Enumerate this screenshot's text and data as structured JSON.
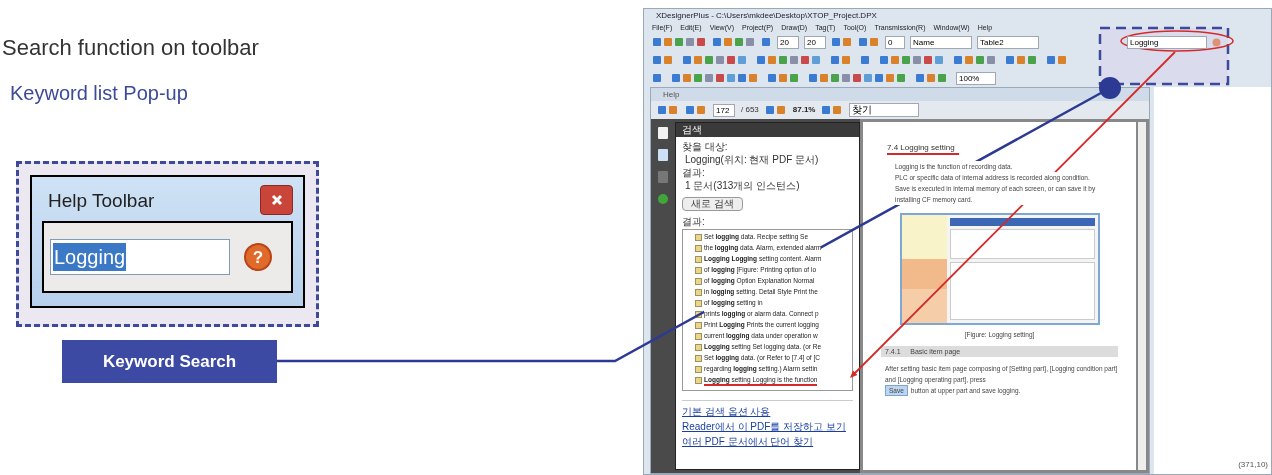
{
  "heading": "Search function on toolbar",
  "subheading": "Keyword list Pop-up",
  "popup": {
    "title": "Help Toolbar",
    "field_value": "Logging",
    "help_glyph": "?"
  },
  "callout_label": "Keyword Search",
  "app": {
    "title": "XDesignerPlus - C:\\Users\\mkdee\\Desktop\\XTOP_Project.DPX",
    "menu": [
      "File(F)",
      "Edit(E)",
      "View(V)",
      "Project(P)",
      "Draw(D)",
      "Tag(T)",
      "Tool(O)",
      "Transmission(R)",
      "Window(W)",
      "Help"
    ],
    "toolbar": {
      "width_value": "20",
      "height_value": "20",
      "layer_value": "0",
      "name_dropdown": "Name",
      "table_dropdown": "Table2",
      "search_value": "Logging",
      "zoom_dropdown": "100%"
    },
    "status": "(371,10)"
  },
  "help_window": {
    "title": "Help",
    "page_current": "172",
    "page_total": "/ 653",
    "zoom": "87.1%",
    "find_field": "찾기",
    "search_panel": {
      "title": "검색",
      "find_label": "찾을 대상:",
      "find_value": "Logging(위치: 현재 PDF 문서)",
      "result_label": "결과:",
      "result_value": "1 문서(313개의 인스턴스)",
      "new_search_button": "새로 검색",
      "results_label": "결과:",
      "results": [
        {
          "text": "Set **logging** data. Recipe setting Se",
          "highlighted": false
        },
        {
          "text": "the **logging** data. Alarm, extended alarm",
          "highlighted": false
        },
        {
          "text": "**Logging Logging** setting content. Alarm",
          "highlighted": false
        },
        {
          "text": "of **logging** [Figure: Printing option of lo",
          "highlighted": false
        },
        {
          "text": "of **logging** Option Explanation Normal",
          "highlighted": false
        },
        {
          "text": "in **logging** setting. Detail Style Print the",
          "highlighted": false
        },
        {
          "text": "of **logging** setting in",
          "highlighted": false
        },
        {
          "text": "prints **logging** or alarm data. Connect p",
          "highlighted": false
        },
        {
          "text": "Print **Logging** Prints the current logging",
          "highlighted": false
        },
        {
          "text": "current **logging** data under operation w",
          "highlighted": false
        },
        {
          "text": "**Logging** setting Set logging data. (or Re",
          "highlighted": false
        },
        {
          "text": "Set **logging** data. (or Refer to [7.4] of [C",
          "highlighted": false
        },
        {
          "text": "regarding **logging** setting.) Alarm settin",
          "highlighted": false
        },
        {
          "text": "**Logging** setting Logging is the function",
          "highlighted": true
        }
      ],
      "links": [
        "기본 검색 옵션 사용",
        "Reader에서 이 PDF를 저장하고 보기",
        "여러 PDF 문서에서 단어 찾기"
      ]
    },
    "document": {
      "section_title": "7.4  Logging setting",
      "paragraphs": [
        "Logging is the function of recording data.",
        "PLC or specific data of internal address is recorded along condition.",
        "Save is executed in internal memory of each screen, or can save it by installing CF memory card."
      ],
      "figure_caption": "[Figure: Logging setting]",
      "subsection_title": "7.4.1     Basic item page",
      "last_paragraph_before": "After setting basic item page composing of [Setting part], [Logging condition part] and [Logging operating part], press",
      "inline_button": "Save",
      "last_paragraph_after": "button at upper part and save logging."
    }
  }
}
